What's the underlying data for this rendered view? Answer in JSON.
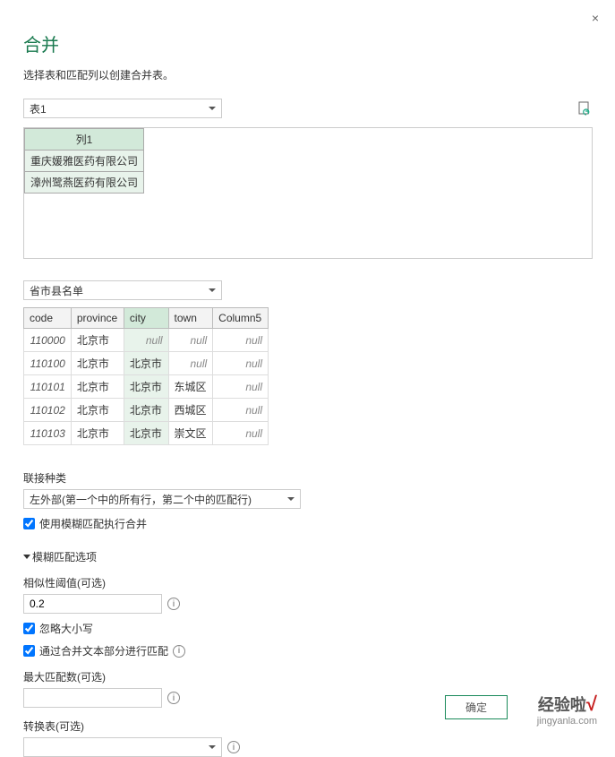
{
  "close_icon": "×",
  "title": "合并",
  "subtitle": "选择表和匹配列以创建合并表。",
  "source1": {
    "selected": "表1",
    "preview_header": "列1",
    "preview_rows": [
      "重庆媛雅医药有限公司",
      "漳州鹭燕医药有限公司"
    ]
  },
  "source2": {
    "selected": "省市县名单",
    "columns": [
      "code",
      "province",
      "city",
      "town",
      "Column5"
    ],
    "selected_col_index": 2,
    "rows": [
      {
        "code": "110000",
        "province": "北京市",
        "city": "null",
        "town": "null",
        "col5": "null",
        "city_null": true,
        "town_null": true
      },
      {
        "code": "110100",
        "province": "北京市",
        "city": "北京市",
        "town": "null",
        "col5": "null",
        "city_null": false,
        "town_null": true
      },
      {
        "code": "110101",
        "province": "北京市",
        "city": "北京市",
        "town": "东城区",
        "col5": "null",
        "city_null": false,
        "town_null": false
      },
      {
        "code": "110102",
        "province": "北京市",
        "city": "北京市",
        "town": "西城区",
        "col5": "null",
        "city_null": false,
        "town_null": false
      },
      {
        "code": "110103",
        "province": "北京市",
        "city": "北京市",
        "town": "崇文区",
        "col5": "null",
        "city_null": false,
        "town_null": false
      }
    ]
  },
  "join_kind": {
    "label": "联接种类",
    "selected": "左外部(第一个中的所有行，第二个中的匹配行)"
  },
  "fuzzy_check": "使用模糊匹配执行合并",
  "fuzzy_header": "模糊匹配选项",
  "threshold": {
    "label": "相似性阈值(可选)",
    "value": "0.2"
  },
  "ignore_case": "忽略大小写",
  "match_text_parts": "通过合并文本部分进行匹配",
  "max_matches": {
    "label": "最大匹配数(可选)",
    "value": ""
  },
  "transform_table": {
    "label": "转换表(可选)",
    "value": ""
  },
  "ok_label": "确定",
  "watermark": {
    "line1": "经验啦",
    "line2": "jingyanla.com"
  }
}
